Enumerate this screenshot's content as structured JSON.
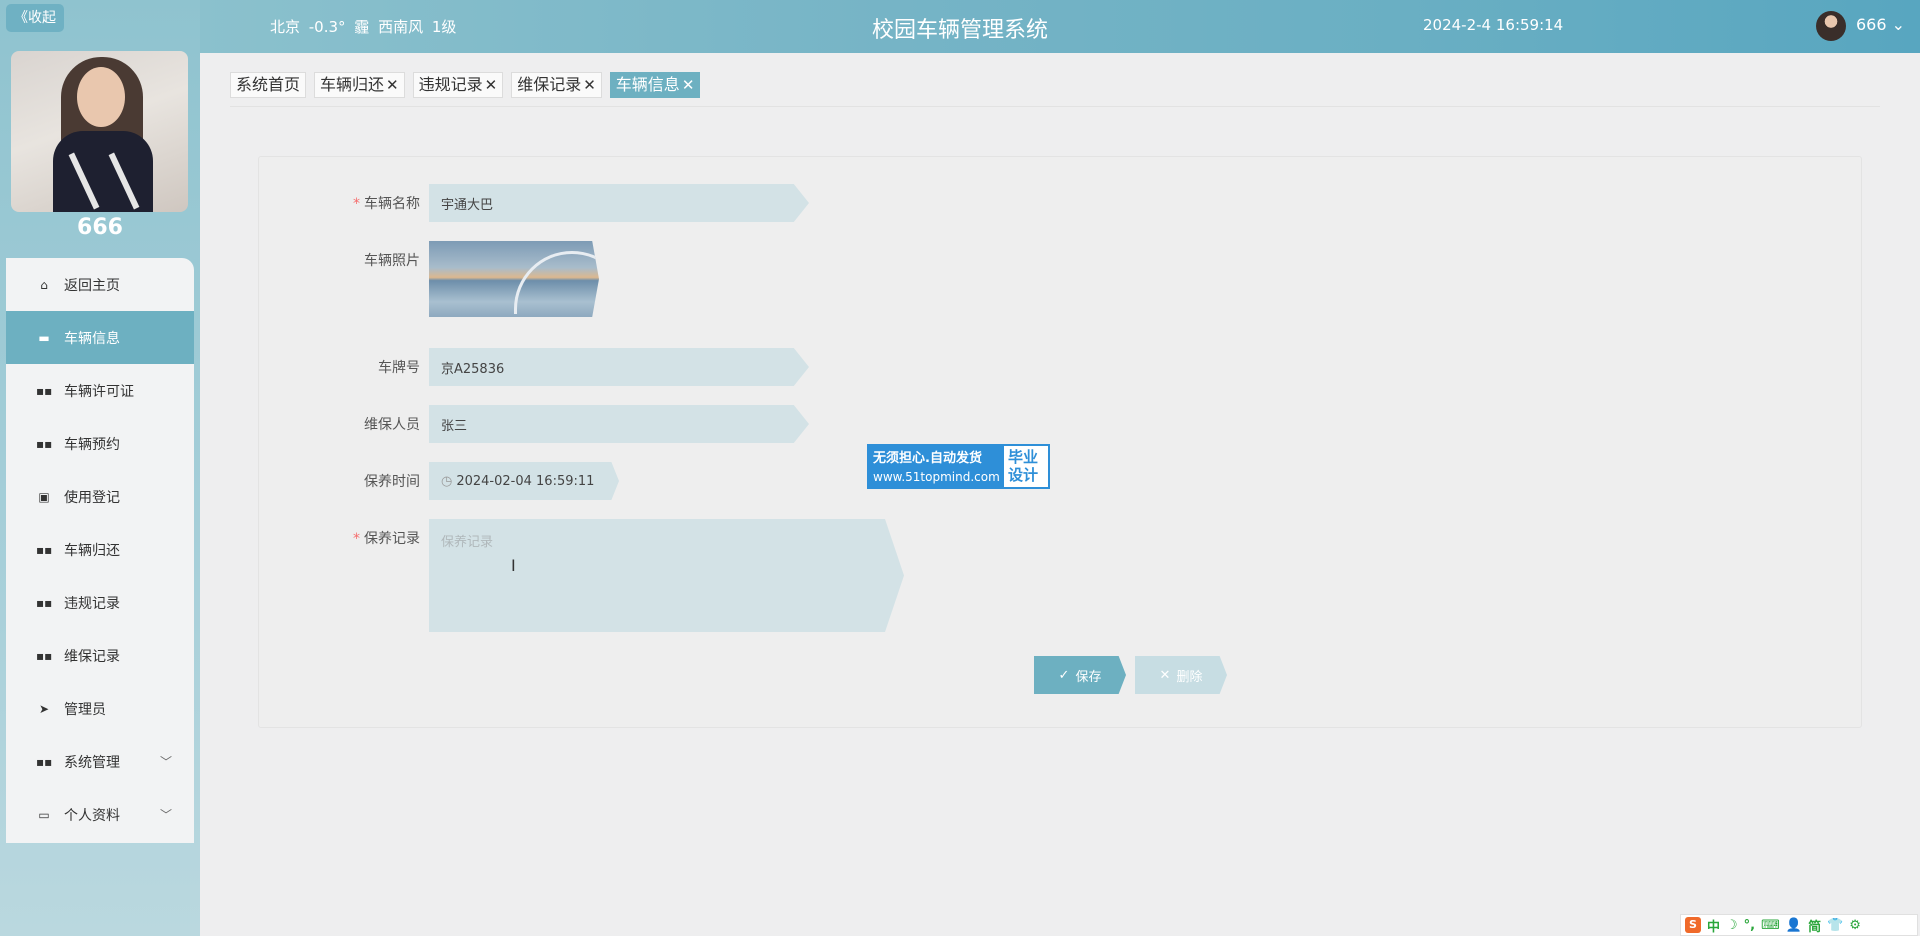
{
  "sidebar": {
    "collapse_label": "《收起",
    "username": "666",
    "items": [
      {
        "label": "返回主页",
        "icon": "home-icon",
        "glyph": "⌂"
      },
      {
        "label": "车辆信息",
        "icon": "chat-icon",
        "glyph": "▬"
      },
      {
        "label": "车辆许可证",
        "icon": "grid-icon",
        "glyph": "▪▪"
      },
      {
        "label": "车辆预约",
        "icon": "grid-icon",
        "glyph": "▪▪"
      },
      {
        "label": "使用登记",
        "icon": "clipboard-icon",
        "glyph": "▣"
      },
      {
        "label": "车辆归还",
        "icon": "grid-icon",
        "glyph": "▪▪"
      },
      {
        "label": "违规记录",
        "icon": "grid-icon",
        "glyph": "▪▪"
      },
      {
        "label": "维保记录",
        "icon": "grid-icon",
        "glyph": "▪▪"
      },
      {
        "label": "管理员",
        "icon": "send-icon",
        "glyph": "➤"
      },
      {
        "label": "系统管理",
        "icon": "grid-icon",
        "glyph": "▪▪"
      },
      {
        "label": "个人资料",
        "icon": "card-icon",
        "glyph": "▭"
      }
    ]
  },
  "header": {
    "weather": "北京 -0.3° 霾 西南风 1级",
    "title": "校园车辆管理系统",
    "datetime": "2024-2-4 16:59:14",
    "user": "666 ⌄"
  },
  "tabs": [
    {
      "label": "系统首页",
      "closable": false
    },
    {
      "label": "车辆归还",
      "closable": true
    },
    {
      "label": "违规记录",
      "closable": true
    },
    {
      "label": "维保记录",
      "closable": true
    },
    {
      "label": "车辆信息",
      "closable": true,
      "active": true
    }
  ],
  "tab_close_glyph": "✕",
  "form": {
    "vehicle_name": {
      "label": "车辆名称",
      "value": "宇通大巴",
      "required": true
    },
    "vehicle_photo": {
      "label": "车辆照片"
    },
    "plate": {
      "label": "车牌号",
      "value": "京A25836"
    },
    "maintainer": {
      "label": "维保人员",
      "value": "张三"
    },
    "maint_time": {
      "label": "保养时间",
      "value": "2024-02-04 16:59:11"
    },
    "maint_record": {
      "label": "保养记录",
      "placeholder": "保养记录",
      "required": true
    },
    "save_label": "保存",
    "delete_label": "删除"
  },
  "ad": {
    "line1": "无须担心.自动发货",
    "line2": "www.51topmind.com",
    "right1": "毕业",
    "right2": "设计"
  },
  "ime": [
    "中",
    "☽",
    "°,",
    "⌨",
    "👤",
    "简",
    "👕",
    "⚙"
  ],
  "colors": {
    "accent": "#6db0c1",
    "required": "#f56c6c"
  }
}
